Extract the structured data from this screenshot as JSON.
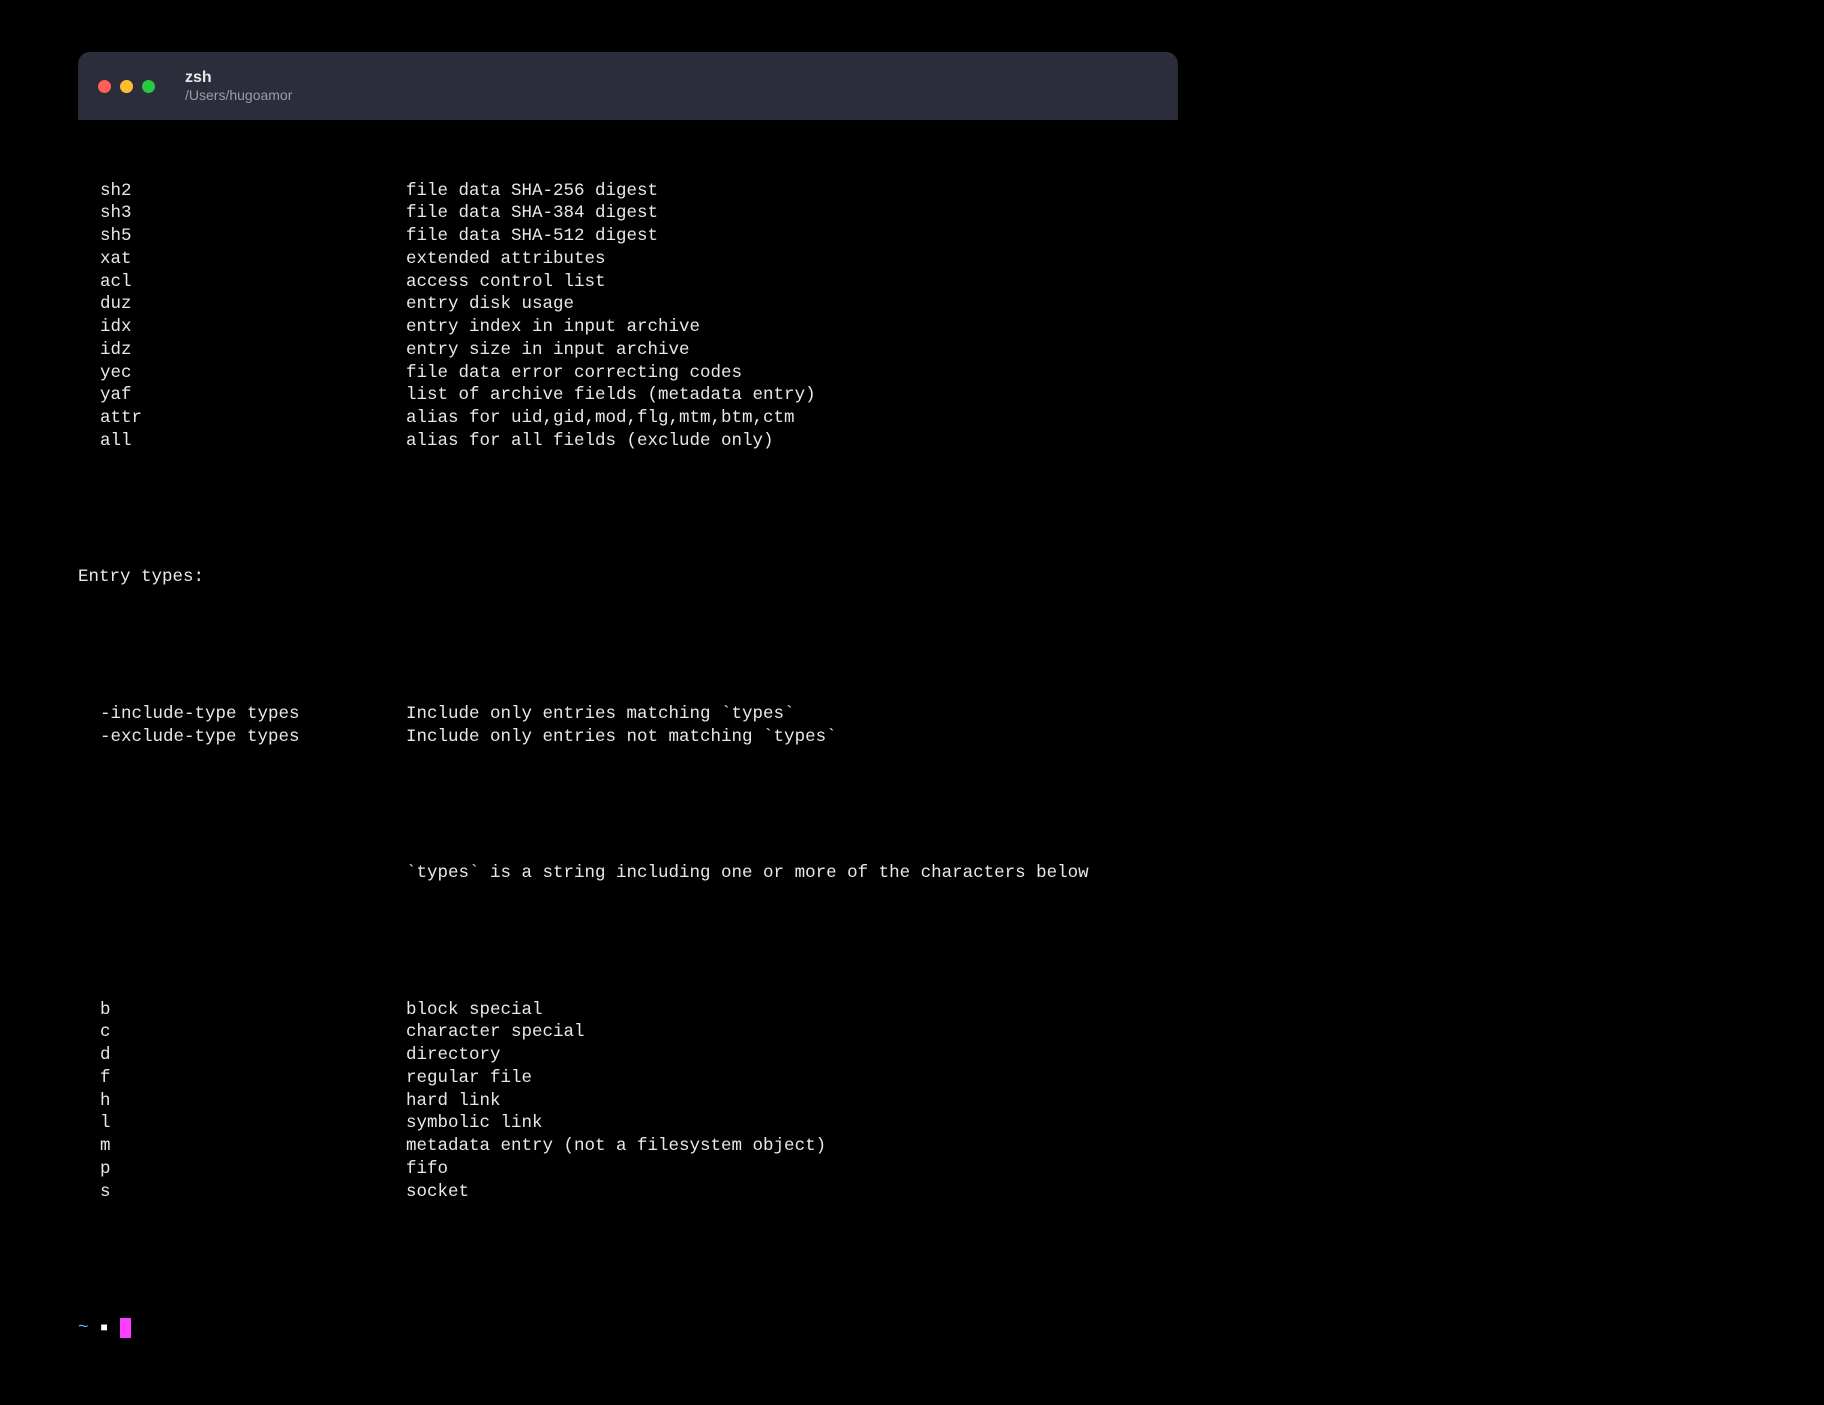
{
  "titlebar": {
    "title": "zsh",
    "subtitle": "/Users/hugoamor"
  },
  "fields": [
    {
      "key": "sh2",
      "desc": "file data SHA-256 digest"
    },
    {
      "key": "sh3",
      "desc": "file data SHA-384 digest"
    },
    {
      "key": "sh5",
      "desc": "file data SHA-512 digest"
    },
    {
      "key": "xat",
      "desc": "extended attributes"
    },
    {
      "key": "acl",
      "desc": "access control list"
    },
    {
      "key": "duz",
      "desc": "entry disk usage"
    },
    {
      "key": "idx",
      "desc": "entry index in input archive"
    },
    {
      "key": "idz",
      "desc": "entry size in input archive"
    },
    {
      "key": "yec",
      "desc": "file data error correcting codes"
    },
    {
      "key": "yaf",
      "desc": "list of archive fields (metadata entry)"
    },
    {
      "key": "attr",
      "desc": "alias for uid,gid,mod,flg,mtm,btm,ctm"
    },
    {
      "key": "all",
      "desc": "alias for all fields (exclude only)"
    }
  ],
  "section_header": "Entry types:",
  "options": [
    {
      "key": "-include-type types",
      "desc": "Include only entries matching `types`"
    },
    {
      "key": "-exclude-type types",
      "desc": "Include only entries not matching `types`"
    }
  ],
  "types_hint": "`types` is a string including one or more of the characters below",
  "types": [
    {
      "key": "b",
      "desc": "block special"
    },
    {
      "key": "c",
      "desc": "character special"
    },
    {
      "key": "d",
      "desc": "directory"
    },
    {
      "key": "f",
      "desc": "regular file"
    },
    {
      "key": "h",
      "desc": "hard link"
    },
    {
      "key": "l",
      "desc": "symbolic link"
    },
    {
      "key": "m",
      "desc": "metadata entry (not a filesystem object)"
    },
    {
      "key": "p",
      "desc": "fifo"
    },
    {
      "key": "s",
      "desc": "socket"
    }
  ],
  "prompt": {
    "tilde": "~",
    "square": "■"
  }
}
